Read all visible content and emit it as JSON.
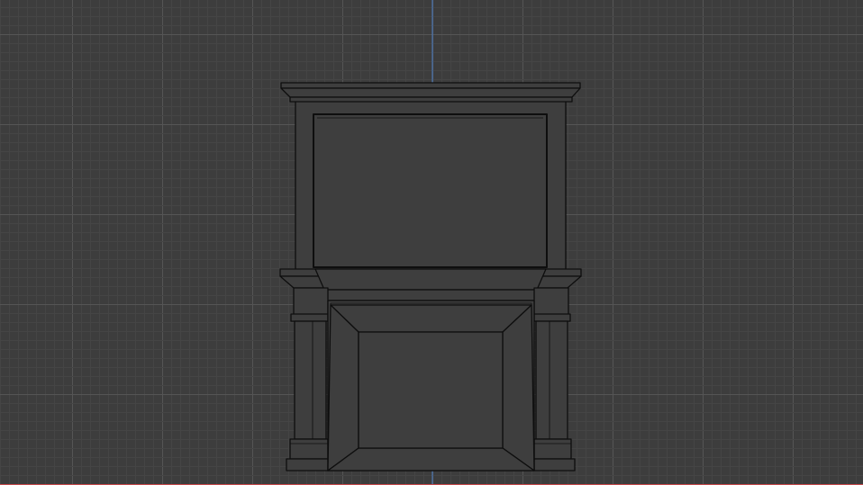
{
  "viewport": {
    "view": "orthographic-front",
    "shading": "solid",
    "overlay": "wireframe",
    "colors": {
      "background": "#3d3d3d",
      "grid_minor": "#454545",
      "grid_major": "#555555",
      "axis_z": "#4b7fc8",
      "axis_x": "#c8494b",
      "mesh_fill": "#3e3e3e",
      "mesh_edge": "#0e0e0e"
    }
  },
  "scene": {
    "object": "fireplace-mantel"
  }
}
